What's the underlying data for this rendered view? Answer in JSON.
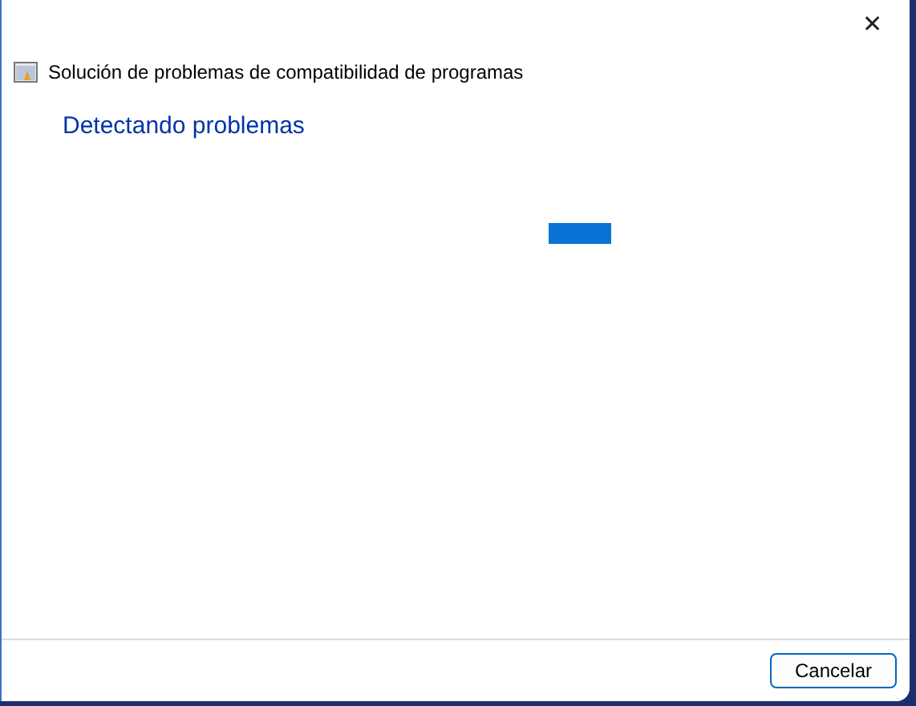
{
  "window": {
    "title": "Solución de problemas de compatibilidad de programas",
    "close_glyph": "✕"
  },
  "heading": "Detectando problemas",
  "progress": {
    "kind": "marquee"
  },
  "buttons": [
    {
      "label": "Cancelar",
      "focused": true
    }
  ]
}
